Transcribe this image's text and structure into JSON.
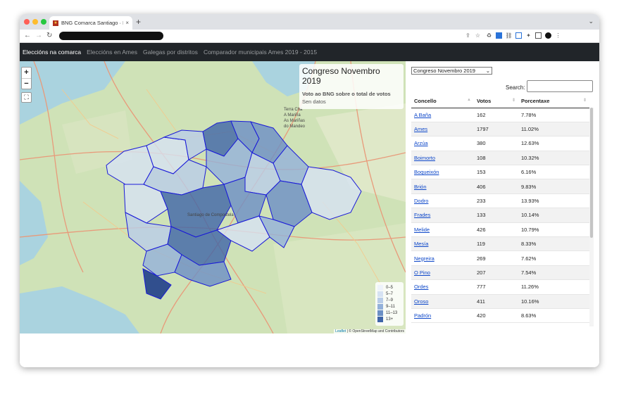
{
  "browser": {
    "tab_title": "BNG Comarca Santiago · Porp",
    "tab_close": "×",
    "new_tab": "+",
    "tab_menu": "⌄",
    "nav": {
      "back": "←",
      "forward": "→",
      "reload": "↻"
    }
  },
  "site_nav": {
    "items": [
      {
        "label": "Eleccións na comarca",
        "active": true
      },
      {
        "label": "Eleccións en Ames",
        "active": false
      },
      {
        "label": "Galegas por distritos",
        "active": false
      },
      {
        "label": "Comparador municipais Ames 2019 - 2015",
        "active": false
      }
    ]
  },
  "map": {
    "zoom_in": "+",
    "zoom_out": "−",
    "fullscreen": "⛶",
    "info": {
      "title": "Congreso Novembro 2019",
      "subtitle": "Voto ao BNG sobre o total de votos",
      "detail": "Sen datos"
    },
    "legend": [
      {
        "label": "0–5",
        "color": "#eef3fb"
      },
      {
        "label": "5–7",
        "color": "#d6e2f3"
      },
      {
        "label": "7–9",
        "color": "#b9cde9"
      },
      {
        "label": "9–11",
        "color": "#93b1da"
      },
      {
        "label": "11–13",
        "color": "#6b8fc5"
      },
      {
        "label": "13+",
        "color": "#3f65a8"
      }
    ],
    "attribution_leaflet": "Leaflet",
    "attribution_osm": "© OpenStreetMap and Contributors",
    "place_labels": [
      "Santiago de Compostela",
      "Terra Chá",
      "A Mariña",
      "As Mariñas",
      "do Mandeo"
    ]
  },
  "panel": {
    "election_select": "Congreso Novembro 2019",
    "search_label": "Search:",
    "search_value": "",
    "columns": [
      "Concello",
      "Votos",
      "Porcentaxe"
    ],
    "rows": [
      {
        "concello": "A Baña",
        "votos": "162",
        "porcentaxe": "7.78%"
      },
      {
        "concello": "Ames",
        "votos": "1797",
        "porcentaxe": "11.02%"
      },
      {
        "concello": "Arzúa",
        "votos": "380",
        "porcentaxe": "12.63%"
      },
      {
        "concello": "Boimorto",
        "votos": "108",
        "porcentaxe": "10.32%"
      },
      {
        "concello": "Boqueixón",
        "votos": "153",
        "porcentaxe": "6.16%"
      },
      {
        "concello": "Brión",
        "votos": "406",
        "porcentaxe": "9.83%"
      },
      {
        "concello": "Dodro",
        "votos": "233",
        "porcentaxe": "13.93%"
      },
      {
        "concello": "Frades",
        "votos": "133",
        "porcentaxe": "10.14%"
      },
      {
        "concello": "Melide",
        "votos": "426",
        "porcentaxe": "10.79%"
      },
      {
        "concello": "Mesía",
        "votos": "119",
        "porcentaxe": "8.33%"
      },
      {
        "concello": "Negreira",
        "votos": "269",
        "porcentaxe": "7.62%"
      },
      {
        "concello": "O Pino",
        "votos": "207",
        "porcentaxe": "7.54%"
      },
      {
        "concello": "Ordes",
        "votos": "777",
        "porcentaxe": "11.26%"
      },
      {
        "concello": "Oroso",
        "votos": "411",
        "porcentaxe": "10.16%"
      },
      {
        "concello": "Padrón",
        "votos": "420",
        "porcentaxe": "8.63%"
      }
    ]
  }
}
